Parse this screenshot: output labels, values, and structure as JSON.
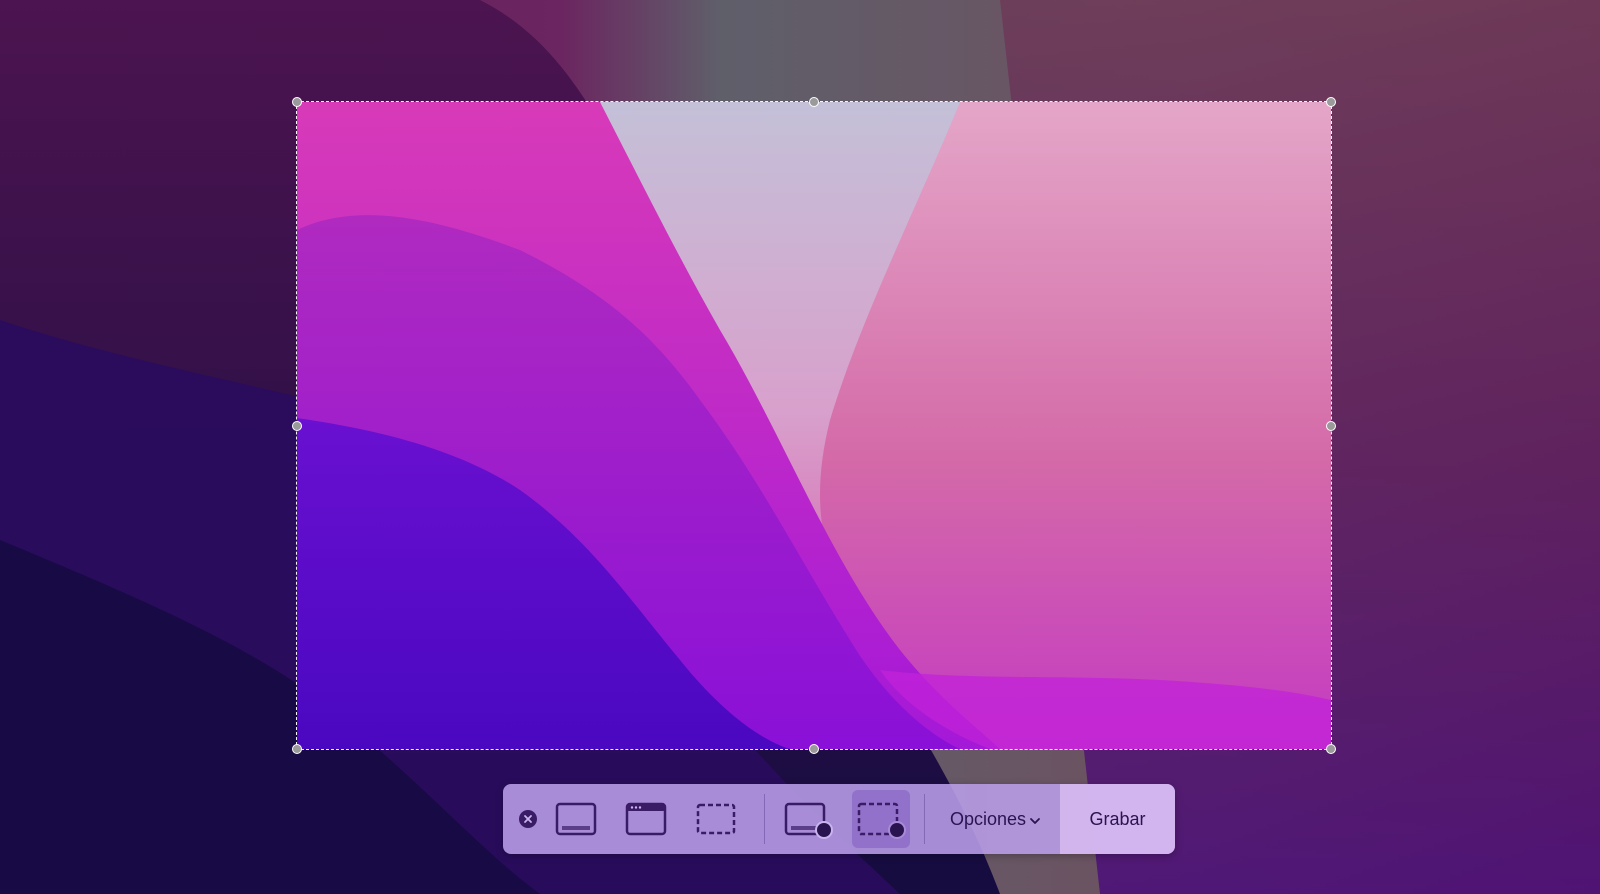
{
  "toolbar": {
    "close_label": "",
    "opciones_label": "Opciones",
    "grabar_label": "Grabar",
    "buttons": [
      {
        "name": "capture-entire-screen",
        "icon": "screen-icon"
      },
      {
        "name": "capture-selected-window",
        "icon": "window-icon"
      },
      {
        "name": "capture-selected-portion",
        "icon": "dashed-rect-icon"
      },
      {
        "name": "record-entire-screen",
        "icon": "screen-record-icon"
      },
      {
        "name": "record-selected-portion",
        "icon": "dashed-rect-record-icon",
        "selected": true
      }
    ]
  },
  "colors": {
    "toolbar_bg": "#b99ee8",
    "icon": "#3a1b66",
    "selection_border": "#ffffff",
    "grabar_bg": "#d6b8f0"
  }
}
